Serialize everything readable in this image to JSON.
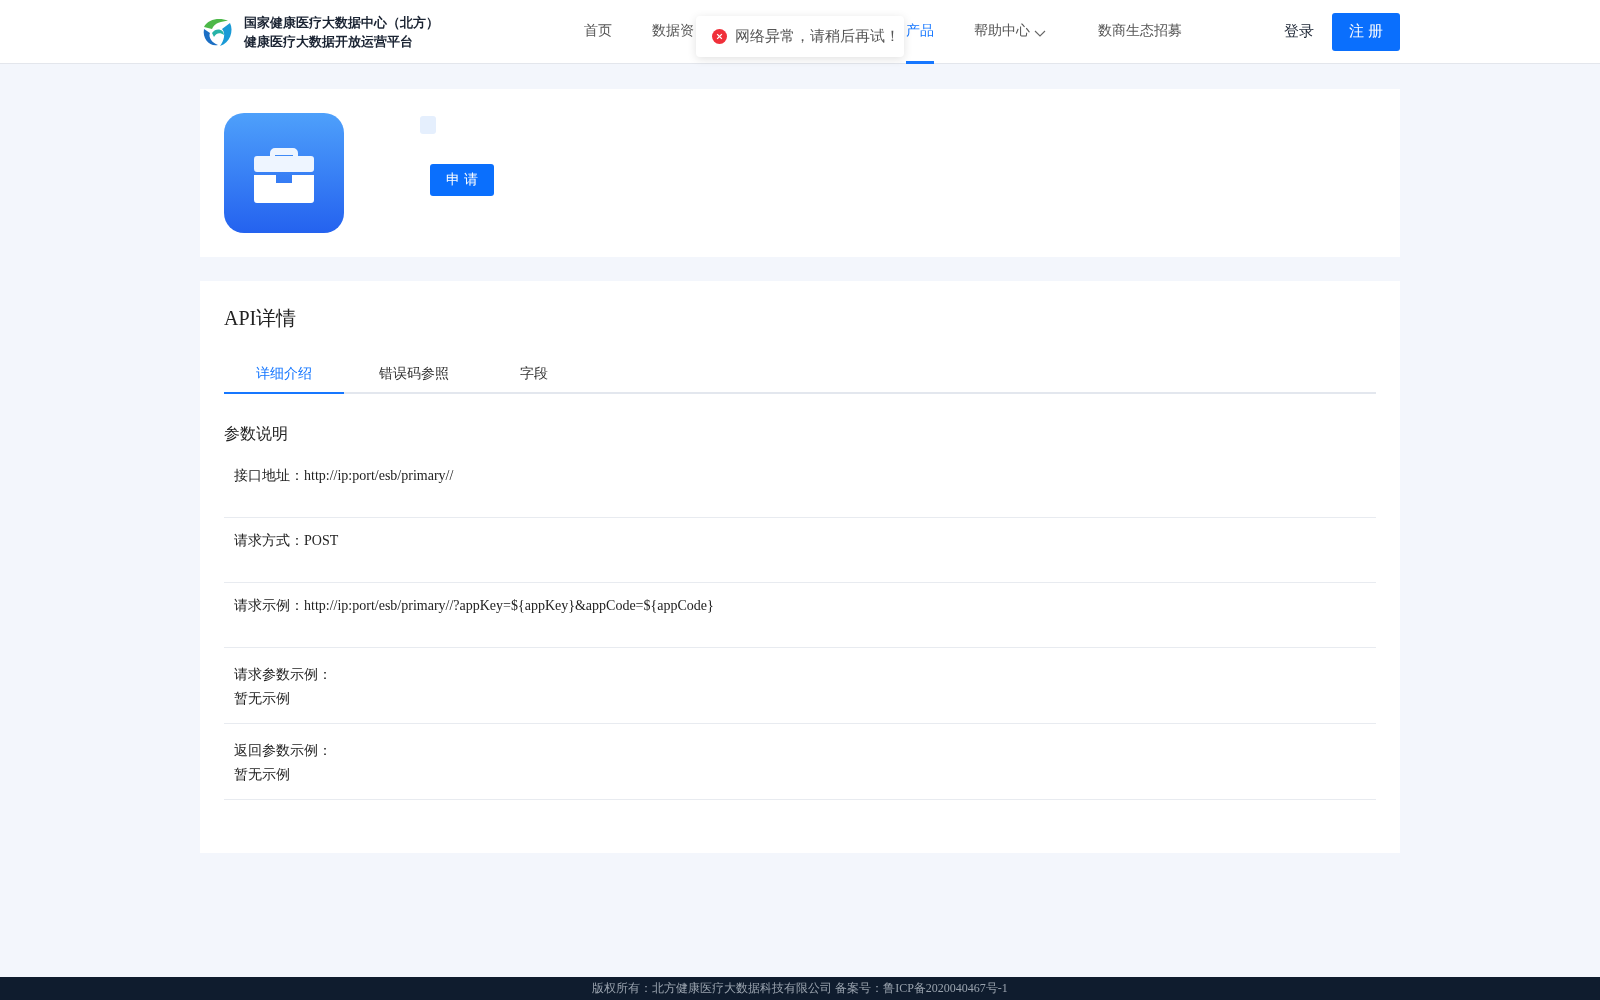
{
  "header": {
    "logo_lines": [
      "国家健康医疗大数据中心（北方）",
      "健康医疗大数据开放运营平台"
    ],
    "nav": [
      {
        "label": "首页",
        "selected": false,
        "dropdown": false
      },
      {
        "label": "数据资",
        "selected": false,
        "dropdown": false
      },
      {
        "label": "产品",
        "selected": true,
        "dropdown": false
      },
      {
        "label": "帮助中心",
        "selected": false,
        "dropdown": true
      },
      {
        "label": "数商生态招募",
        "selected": false,
        "dropdown": false
      }
    ],
    "login": "登录",
    "register": "注 册"
  },
  "toast": {
    "kind": "error",
    "message": "网络异常，请稍后再试！"
  },
  "product": {
    "apply_button": "申 请"
  },
  "api_detail": {
    "title": "API详情",
    "tabs": [
      {
        "label": "详细介绍",
        "selected": true
      },
      {
        "label": "错误码参照",
        "selected": false
      },
      {
        "label": "字段",
        "selected": false
      }
    ],
    "section_title": "参数说明",
    "params": [
      {
        "kind": "inline",
        "label": "接口地址：",
        "value": "http://ip:port/esb/primary//"
      },
      {
        "kind": "inline",
        "label": "请求方式：",
        "value": "POST"
      },
      {
        "kind": "inline",
        "label": "请求示例：",
        "value": "http://ip:port/esb/primary//?appKey=${appKey}&appCode=${appCode}"
      },
      {
        "kind": "stacked",
        "label": "请求参数示例：",
        "value": "暂无示例"
      },
      {
        "kind": "stacked",
        "label": "返回参数示例：",
        "value": "暂无示例"
      }
    ]
  },
  "footer": {
    "text": "版权所有：北方健康医疗大数据科技有限公司 备案号：鲁ICP备2020040467号-1"
  }
}
